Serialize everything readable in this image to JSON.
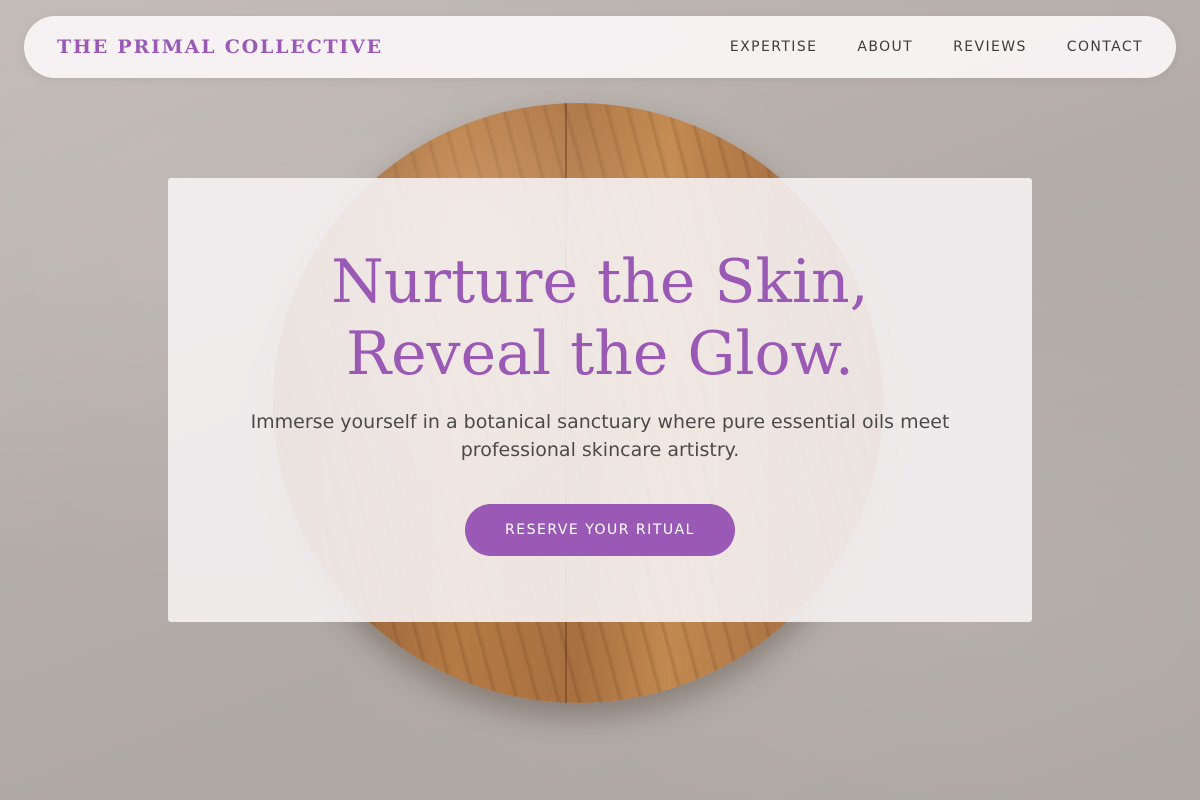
{
  "brand": {
    "name": "THE PRIMAL COLLECTIVE"
  },
  "nav": {
    "items": [
      {
        "label": "EXPERTISE"
      },
      {
        "label": "ABOUT"
      },
      {
        "label": "REVIEWS"
      },
      {
        "label": "CONTACT"
      }
    ]
  },
  "hero": {
    "title_line_1": "Nurture the Skin,",
    "title_line_2": "Reveal the Glow.",
    "subtitle": "Immerse yourself in a botanical sanctuary where pure essential oils meet professional skincare artistry.",
    "cta_label": "RESERVE YOUR RITUAL"
  },
  "colors": {
    "accent": "#9b59b6",
    "nav_text": "#3d3d3d",
    "body_text": "#4a4a4a",
    "card_background": "#f5f2f3"
  }
}
